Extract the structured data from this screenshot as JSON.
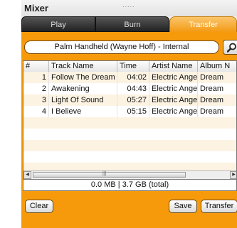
{
  "window": {
    "title": "Mixer",
    "grip": "....."
  },
  "tabs": [
    {
      "label": "Play"
    },
    {
      "label": "Burn"
    },
    {
      "label": "Transfer",
      "active": true
    }
  ],
  "device": {
    "label": "Palm Handheld (Wayne Hoff) - Internal"
  },
  "table": {
    "columns": [
      "#",
      "Track Name",
      "Time",
      "Artist Name",
      "Album N"
    ],
    "rows": [
      {
        "num": "1",
        "track": "Follow The Dream",
        "time": "04:02",
        "artist": "Electric Angel",
        "album": "Dream"
      },
      {
        "num": "2",
        "track": "Awakening",
        "time": "04:43",
        "artist": "Electric Angel",
        "album": "Dream"
      },
      {
        "num": "3",
        "track": "Light Of Sound",
        "time": "05:27",
        "artist": "Electric Angel",
        "album": "Dream"
      },
      {
        "num": "4",
        "track": "I Believe",
        "time": "05:15",
        "artist": "Electric Angel",
        "album": "Dream"
      }
    ],
    "empty_rows": 7
  },
  "status": {
    "text": "0.0 MB | 3.7 GB (total)"
  },
  "buttons": {
    "clear": "Clear",
    "save": "Save",
    "transfer": "Transfer"
  },
  "colors": {
    "accent": "#f69a0c",
    "tab_dark": "#333333",
    "row_alt": "#fdf3e3"
  },
  "icons": {
    "search": "search-icon",
    "scroll_left": "scroll-left-arrow-icon",
    "scroll_right": "scroll-right-arrow-icon"
  }
}
